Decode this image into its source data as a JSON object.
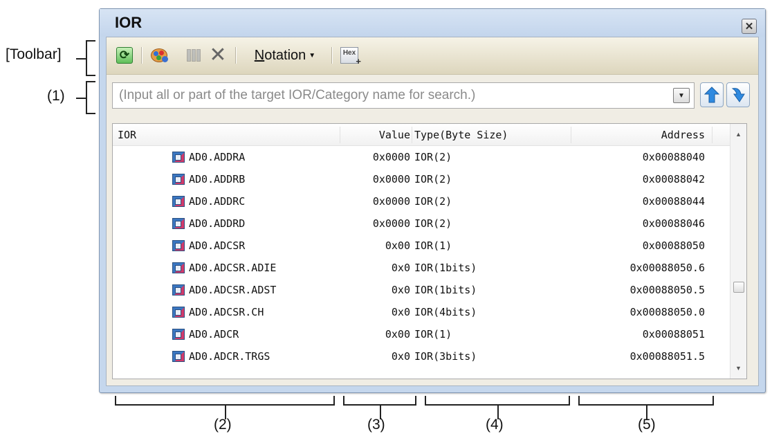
{
  "annotations": {
    "toolbar": "[Toolbar]",
    "search": "(1)",
    "col_ior": "(2)",
    "col_value": "(3)",
    "col_type": "(4)",
    "col_address": "(5)"
  },
  "window": {
    "title": "IOR",
    "close_glyph": "✕"
  },
  "toolbar": {
    "refresh_icon": "refresh-icon",
    "color_icon": "palette-icon",
    "columns_icon": "columns-icon",
    "delete_glyph": "✕",
    "notation_prefix": "N",
    "notation_rest": "otation",
    "notation_caret": "▼",
    "hex_label": "Hex",
    "hex_plus": "+"
  },
  "search": {
    "placeholder": "(Input all or part of the target IOR/Category name for search.)",
    "value": "",
    "dropdown_glyph": "▼",
    "prev_icon": "arrow-up-icon",
    "next_icon": "arrow-down-icon"
  },
  "table": {
    "headers": {
      "ior": "IOR",
      "value": "Value",
      "type": "Type(Byte Size)",
      "address": "Address"
    },
    "rows": [
      {
        "name": "AD0.ADDRA",
        "value": "0x0000",
        "type": "IOR(2)",
        "address": "0x00088040"
      },
      {
        "name": "AD0.ADDRB",
        "value": "0x0000",
        "type": "IOR(2)",
        "address": "0x00088042"
      },
      {
        "name": "AD0.ADDRC",
        "value": "0x0000",
        "type": "IOR(2)",
        "address": "0x00088044"
      },
      {
        "name": "AD0.ADDRD",
        "value": "0x0000",
        "type": "IOR(2)",
        "address": "0x00088046"
      },
      {
        "name": "AD0.ADCSR",
        "value": "0x00",
        "type": "IOR(1)",
        "address": "0x00088050"
      },
      {
        "name": "AD0.ADCSR.ADIE",
        "value": "0x0",
        "type": "IOR(1bits)",
        "address": "0x00088050.6"
      },
      {
        "name": "AD0.ADCSR.ADST",
        "value": "0x0",
        "type": "IOR(1bits)",
        "address": "0x00088050.5"
      },
      {
        "name": "AD0.ADCSR.CH",
        "value": "0x0",
        "type": "IOR(4bits)",
        "address": "0x00088050.0"
      },
      {
        "name": "AD0.ADCR",
        "value": "0x00",
        "type": "IOR(1)",
        "address": "0x00088051"
      },
      {
        "name": "AD0.ADCR.TRGS",
        "value": "0x0",
        "type": "IOR(3bits)",
        "address": "0x00088051.5"
      }
    ],
    "scroll_up_glyph": "▲",
    "scroll_down_glyph": "▼"
  },
  "colors": {
    "window_frame": "#c5d7ed",
    "toolbar_bg": "#ece6cf",
    "panel_bg": "#f0ede4"
  }
}
